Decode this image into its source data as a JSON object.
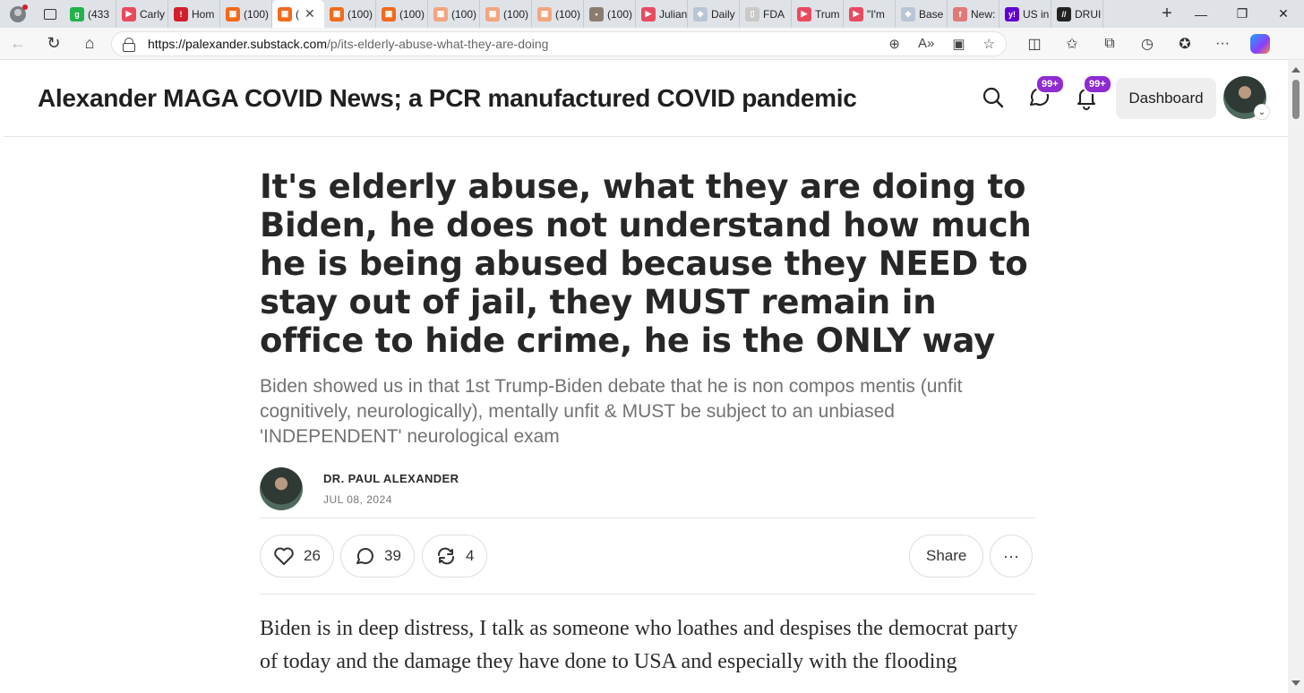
{
  "browser": {
    "tabs": [
      {
        "label": "(433",
        "color": "#22b24c",
        "glyph": "g"
      },
      {
        "label": "Carly",
        "color": "#e84a5f",
        "glyph": "▶"
      },
      {
        "label": "Hom",
        "color": "#d21f2c",
        "glyph": "!"
      },
      {
        "label": "(100)",
        "color": "#f26a1b",
        "glyph": "▦"
      },
      {
        "label": "(",
        "color": "#f26a1b",
        "glyph": "▦",
        "active": true
      },
      {
        "label": "(100)",
        "color": "#f26a1b",
        "glyph": "▦"
      },
      {
        "label": "(100)",
        "color": "#f26a1b",
        "glyph": "▦"
      },
      {
        "label": "(100)",
        "color": "#f4a47e",
        "glyph": "▦"
      },
      {
        "label": "(100)",
        "color": "#f4a47e",
        "glyph": "▦"
      },
      {
        "label": "(100)",
        "color": "#f4a47e",
        "glyph": "▦"
      },
      {
        "label": "(100)",
        "color": "#8a7d70",
        "glyph": "▪"
      },
      {
        "label": "Julian",
        "color": "#e84a5f",
        "glyph": "▶"
      },
      {
        "label": "Daily",
        "color": "#b8c6d6",
        "glyph": "◈"
      },
      {
        "label": "FDA",
        "color": "#c9c9c9",
        "glyph": "▯"
      },
      {
        "label": "Trum",
        "color": "#e84a5f",
        "glyph": "▶"
      },
      {
        "label": "\"I'm",
        "color": "#e84a5f",
        "glyph": "▶"
      },
      {
        "label": "Base",
        "color": "#b8c6d6",
        "glyph": "◈"
      },
      {
        "label": "New:",
        "color": "#e07a7a",
        "glyph": "f"
      },
      {
        "label": "US in",
        "color": "#6001d2",
        "glyph": "y!"
      },
      {
        "label": "DRUI",
        "color": "#222222",
        "glyph": "//"
      }
    ],
    "close_glyph": "✕",
    "new_tab_glyph": "+",
    "url_domain": "https://palexander.substack.com",
    "url_path": "/p/its-elderly-abuse-what-they-are-doing"
  },
  "site": {
    "publication_title": "Alexander MAGA COVID News; a PCR manufactured COVID pandemic",
    "chat_badge": "99+",
    "bell_badge": "99+",
    "dashboard_label": "Dashboard"
  },
  "article": {
    "title": "It's elderly abuse, what they are doing to Biden, he does not understand how much he is being abused because they NEED to stay out of jail, they MUST remain in office to hide crime, he is the ONLY way",
    "subtitle": "Biden showed us in that 1st Trump-Biden debate that he is non compos mentis (unfit cognitively, neurologically), mentally unfit & MUST be subject to an unbiased 'INDEPENDENT' neurological exam",
    "author": "DR. PAUL ALEXANDER",
    "date": "JUL 08, 2024",
    "likes": "26",
    "comments": "39",
    "restacks": "4",
    "share_label": "Share",
    "more_glyph": "···",
    "body_start": "Biden is in deep distress, I talk as someone who loathes and despises the democrat party of today and the damage they have done to USA and especially with the flooding"
  }
}
